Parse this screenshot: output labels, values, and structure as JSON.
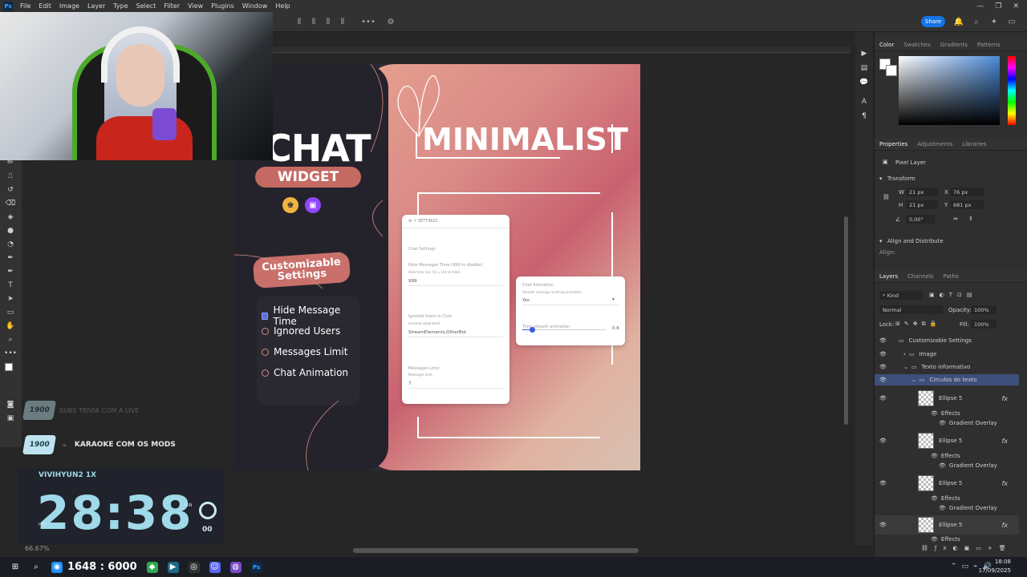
{
  "app": {
    "logo": "Ps",
    "menu": [
      "File",
      "Edit",
      "Image",
      "Layer",
      "Type",
      "Select",
      "Filter",
      "View",
      "Plugins",
      "Window",
      "Help"
    ],
    "window_controls": [
      "—",
      "❐",
      "✕"
    ],
    "share_label": "Share",
    "zoom_status": "66.67%"
  },
  "canvas": {
    "chat_title": "CHAT",
    "widget_label": "WIDGET",
    "minimalist_title": "MINIMALIST",
    "customizable_line1": "Customizable",
    "customizable_line2": "Settings",
    "features": [
      "Hide Message Time",
      "Ignored Users",
      "Messages Limit",
      "Chat Animation"
    ],
    "settings_card": {
      "header": "⚙ ↑ SETTINGS",
      "section": "Chat Settings",
      "hide_label": "Hide Messages Time (999 to disable)",
      "hide_hint": "Hide time (ex: 10 = 10s to hide)",
      "hide_value": "999",
      "ignored_label": "Ignored Users in Chat",
      "ignored_hint": "(comma separated)",
      "ignored_value": "StreamElements,OtherBot",
      "limit_label": "Messages Limit",
      "limit_hint": "Messages limit",
      "limit_value": "7"
    },
    "animation_card": {
      "label": "Chat Animation",
      "hint": "Smooth message scrolling animation",
      "value": "Yes",
      "slider_label": "Time smooth animation",
      "slider_value": "0.6",
      "slider_fraction": 0.12
    }
  },
  "overlay": {
    "faded_badge": "1900",
    "faded_text": "SUBS TRIVIA COM A LIVE",
    "sub_badge": "1900",
    "karaoke_text": "KARAOKE COM OS MODS",
    "timer_user": "VIVIHYUN2 1X",
    "timer_time": "28:38",
    "timer_min_label": "MIN",
    "timer_sec": "00",
    "timer_hrs_label": "HRS"
  },
  "panels": {
    "color_tabs": [
      "Color",
      "Swatches",
      "Gradients",
      "Patterns"
    ],
    "props_tabs": [
      "Properties",
      "Adjustments",
      "Libraries"
    ],
    "pixel_layer": "Pixel Layer",
    "transform": "Transform",
    "w": "21 px",
    "h": "21 px",
    "x": "76 px",
    "y": "681 px",
    "angle": "0,00°",
    "align": "Align and Distribute",
    "align_sub": "Align:",
    "layers_tabs": [
      "Layers",
      "Channels",
      "Paths"
    ],
    "kind": "Kind",
    "blend": "Normal",
    "opacity_label": "Opacity:",
    "opacity": "100%",
    "lock_label": "Lock:",
    "fill_label": "Fill:",
    "fill": "100%",
    "layers": [
      {
        "name": "Customizable Settings",
        "indent": 0,
        "type": "group"
      },
      {
        "name": "Image",
        "indent": 1,
        "type": "group"
      },
      {
        "name": "Texto informativo",
        "indent": 1,
        "type": "group"
      },
      {
        "name": "Circulos do texto",
        "indent": 2,
        "type": "group",
        "selected": true
      }
    ],
    "ellipse_name": "Ellipse 5",
    "effects_label": "Effects",
    "gradient_label": "Gradient Overlay",
    "fx_label": "fx"
  },
  "taskbar": {
    "counter": "1648 : 6000",
    "time": "18:08",
    "date": "17/09/2025"
  }
}
